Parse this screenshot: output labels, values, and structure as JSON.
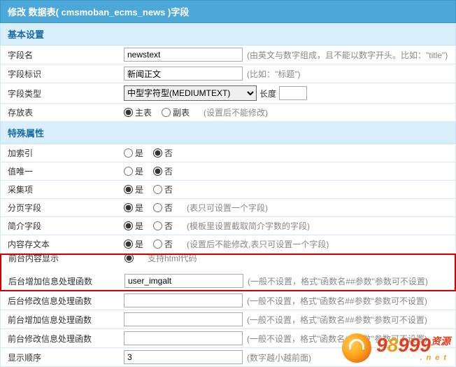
{
  "title": "修改 数据表( cmsmoban_ecms_news )字段",
  "sections": {
    "basic": "基本设置",
    "special": "特殊属性"
  },
  "labels": {
    "field_name": "字段名",
    "field_mark": "字段标识",
    "field_type": "字段类型",
    "store_table": "存放表",
    "add_index": "加索引",
    "unique": "值唯一",
    "collect": "采集项",
    "paging": "分页字段",
    "brief": "简介字段",
    "content": "内容存文本",
    "cutoff_label": "前台内容显示",
    "back_add_fn": "后台增加信息处理函数",
    "back_mod_fn": "后台修改信息处理函数",
    "front_add_fn": "前台增加信息处理函数",
    "front_mod_fn": "前台修改信息处理函数",
    "display_order": "显示顺序"
  },
  "values": {
    "field_name": "newstext",
    "field_mark": "新闻正文",
    "field_type_selected": "中型字符型(MEDIUMTEXT)",
    "length_label": "长度",
    "length": "",
    "back_add_fn": "user_imgalt",
    "back_mod_fn": "",
    "front_add_fn": "",
    "front_mod_fn": "",
    "display_order": "3"
  },
  "radio": {
    "yes": "是",
    "no": "否",
    "main_table": "主表",
    "sub_table": "副表"
  },
  "hints": {
    "field_name": "(由英文与数字组成，且不能以数字开头。比如：\"title\")",
    "field_mark": "(比如：\"标题\")",
    "store_table": "(设置后不能修改)",
    "paging": "(表只可设置一个字段)",
    "brief": "(模板里设置截取简介字数的字段)",
    "content": "(设置后不能修改,表只可设置一个字段)",
    "cutoff_hint": "支持html代码",
    "fn_hint": "(一般不设置，格式\"函数名##参数\"参数可不设置)",
    "display_order": "(数字越小越前面)"
  },
  "watermark": {
    "domain_nine": "9",
    "domain_eight": "8",
    "domain_rest": "999",
    "sub": ".net",
    "zh": "资源"
  }
}
